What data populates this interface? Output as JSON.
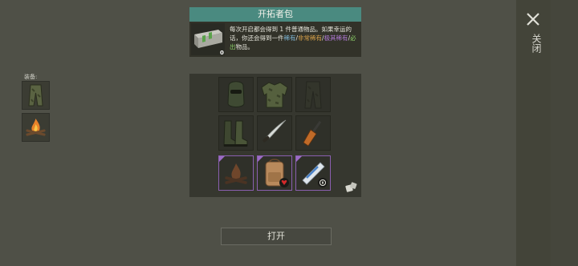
{
  "window": {
    "close_label": "关闭"
  },
  "equipment": {
    "label": "装备:",
    "slots": [
      {
        "icon": "pants-icon"
      },
      {
        "icon": "campfire-icon"
      }
    ]
  },
  "pack": {
    "title": "开拓者包",
    "count": "0",
    "desc": {
      "part1": "每次开启都会得到 1 件普通物品。如果幸运的话，你还会得到一件",
      "rare": "稀有",
      "sep1": "/",
      "very_rare": "非常稀有",
      "sep2": "/",
      "epic": "极其稀有",
      "sep3": "/",
      "guaranteed": "必出",
      "part2": "物品。"
    }
  },
  "items": [
    {
      "icon": "balaclava-icon",
      "rarity": "common"
    },
    {
      "icon": "camo-jacket-icon",
      "rarity": "common"
    },
    {
      "icon": "camo-pants-icon",
      "rarity": "common"
    },
    {
      "icon": "boots-icon",
      "rarity": "common"
    },
    {
      "icon": "machete-icon",
      "rarity": "common"
    },
    {
      "icon": "rifle-icon",
      "rarity": "common"
    },
    {
      "icon": "campfire-icon",
      "rarity": "guaranteed"
    },
    {
      "icon": "backpack-icon",
      "rarity": "guaranteed"
    },
    {
      "icon": "map-scroll-icon",
      "rarity": "guaranteed"
    }
  ],
  "open_button": "打开",
  "colors": {
    "header": "#4a8a80",
    "rare": "#7fb8d8",
    "very_rare": "#d9a24a",
    "epic": "#b17ad6",
    "guaranteed": "#8fd46a",
    "slot_border_guaranteed": "#8a5fb0"
  }
}
